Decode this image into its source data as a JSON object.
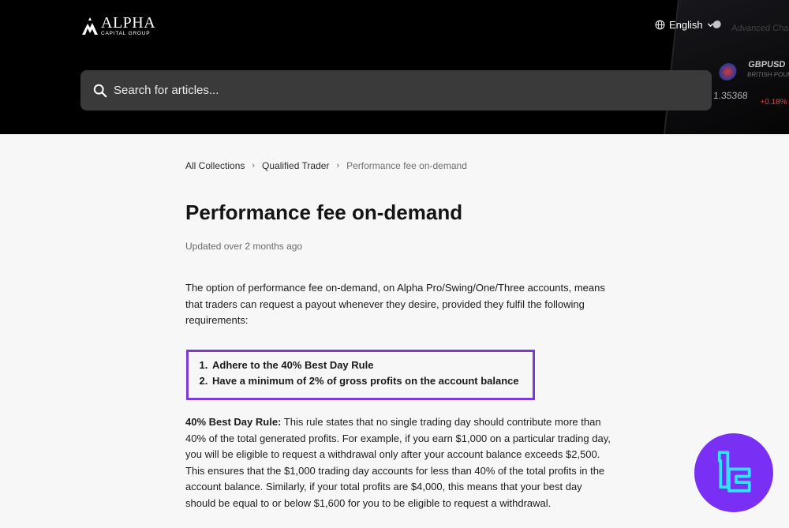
{
  "header": {
    "logo": {
      "name": "ALPHA",
      "tagline": "CAPITAL GROUP"
    },
    "language": "English",
    "search": {
      "placeholder": "Search for articles..."
    }
  },
  "breadcrumb": {
    "items": [
      "All Collections",
      "Qualified Trader",
      "Performance fee on-demand"
    ]
  },
  "article": {
    "title": "Performance fee on-demand",
    "updated": "Updated over 2 months ago",
    "intro": "The option of performance fee on-demand, on Alpha Pro/Swing/One/Three accounts, means that traders can request a payout whenever they desire, provided they fulfil the following requirements:",
    "requirements": [
      "Adhere to the 40% Best Day Rule",
      "Have a minimum of 2% of gross profits on the account balance"
    ],
    "rule_heading": "40% Best Day Rule:",
    "rule_body": " This rule states that no single trading day should contribute more than 40% of the total generated profits. For example, if you earn $1,000 on a particular trading day, you will be eligible to request a withdrawal only after your account balance exceeds $2,500. This ensures that the $1,000 trading day accounts for less than 40% of the total profits in the account balance. Similarly, if your total profits are $4,000, this means that your best day should be equal to or below $1,600 for you to be eligible to request a withdrawal."
  },
  "decor": {
    "phone_texts": [
      "Advanced Chart",
      "GBPUSD",
      "BRITISH POUND",
      "1.35368",
      "+0.18%"
    ]
  },
  "colors": {
    "header_bg": "#000000",
    "search_bg": "#3a3a3a",
    "highlight_border": "#7a3bd8",
    "badge_bg": "#7a2ff5",
    "badge_glyph": "#33e0ff"
  },
  "icons": {
    "logo": "alpha-logo-icon",
    "globe": "globe-icon",
    "chevron": "chevron-down-icon",
    "search": "search-icon",
    "badge": "tradingfinder-badge-icon"
  }
}
